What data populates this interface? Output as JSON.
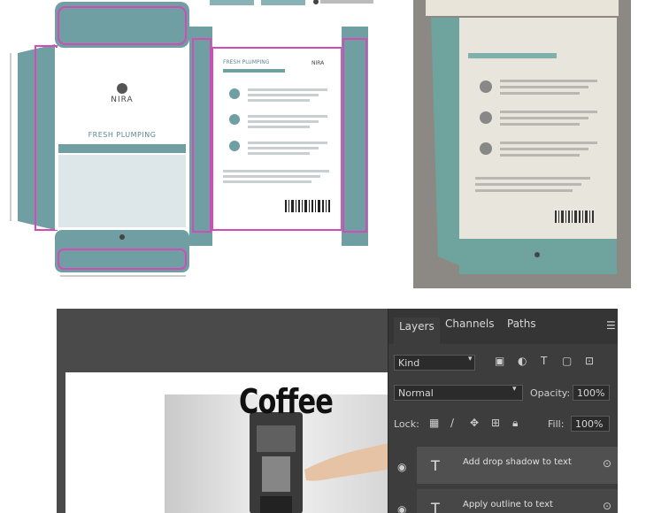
{
  "dieline": {
    "brand": "NIRA",
    "product_title": "FRESH PLUMPING",
    "back_title": "FRESH PLUMPING",
    "back_brand": "NIRA"
  },
  "photoshop": {
    "tabs": [
      "Layers",
      "Channels",
      "Paths"
    ],
    "filter_kind": "Kind",
    "blend_mode": "Normal",
    "opacity_label": "Opacity:",
    "opacity_value": "100%",
    "lock_label": "Lock:",
    "fill_label": "Fill:",
    "fill_value": "100%",
    "layers": [
      {
        "name": "Add drop shadow to text"
      },
      {
        "name": "Apply outline to text"
      }
    ],
    "canvas_text": "Coffee"
  },
  "colors": {
    "teal": "#6f9ea3",
    "magenta": "#d24bb7",
    "ps_bg": "#4a4a4a"
  }
}
